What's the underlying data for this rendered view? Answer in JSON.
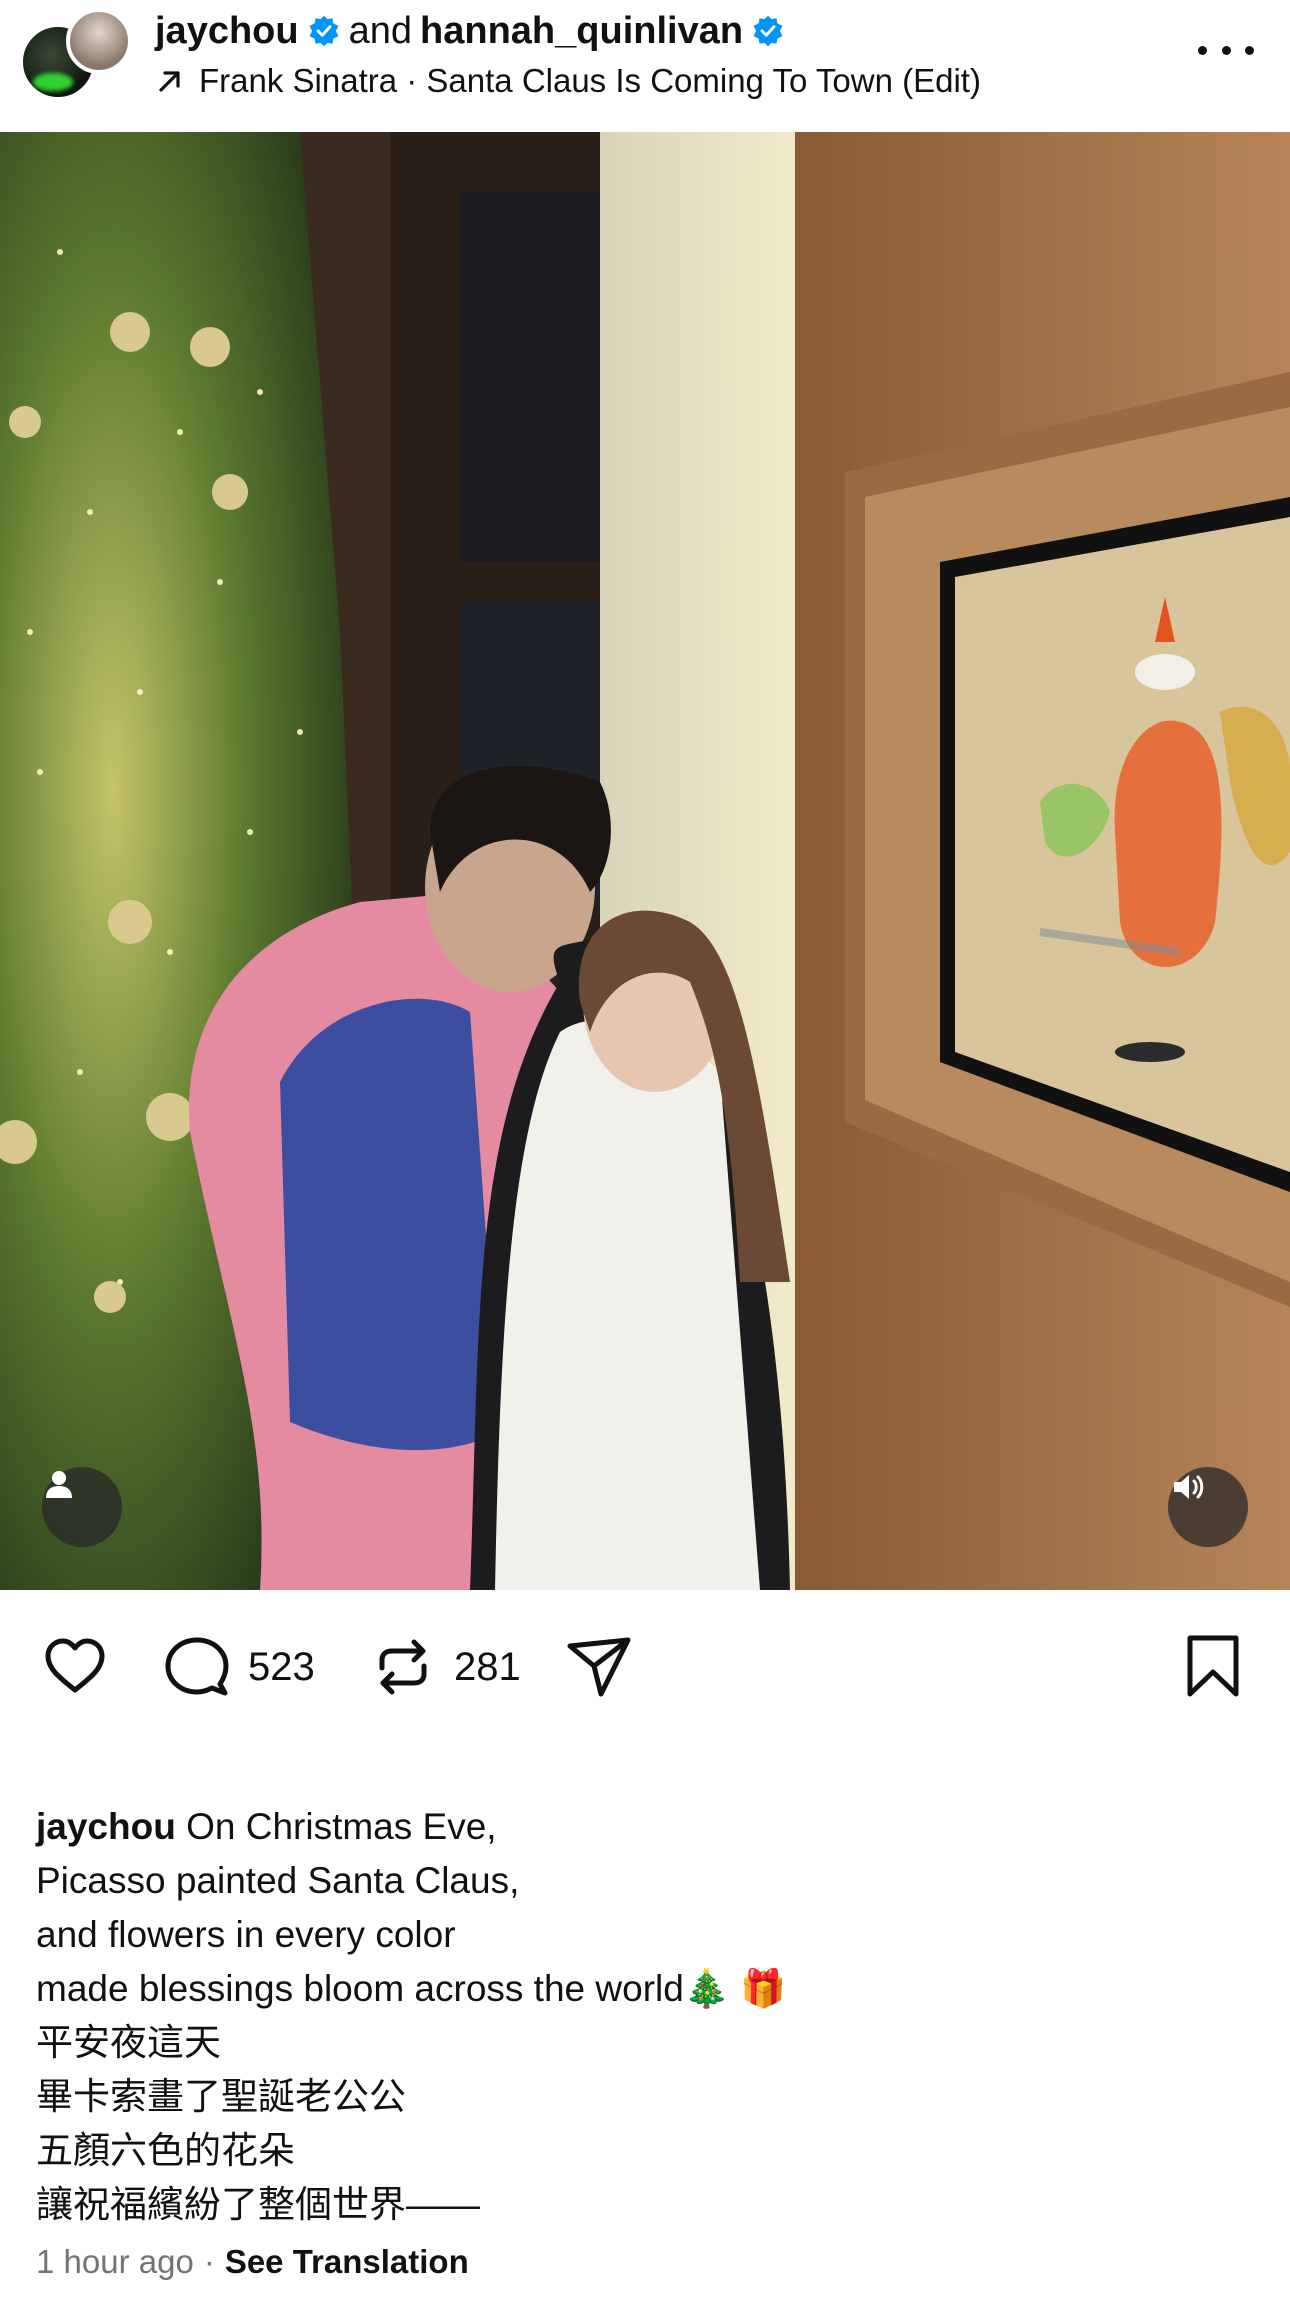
{
  "header": {
    "user1": "jaychou",
    "joiner": "and",
    "user2": "hannah_quinlivan",
    "audio": "Frank Sinatra · Santa Claus Is Coming To Town (Edit)"
  },
  "actions": {
    "comments": "523",
    "reposts": "281"
  },
  "caption": {
    "author": "jaychou",
    "lines": [
      "On Christmas Eve,",
      "Picasso painted Santa Claus,",
      "and flowers in every color",
      "made blessings bloom across the world",
      "平安夜這天",
      "畢卡索畫了聖誕老公公",
      "五顏六色的花朵",
      "讓祝福繽紛了整個世界——"
    ],
    "emojis": "🎄 🎁"
  },
  "meta": {
    "time": "1 hour ago",
    "dot": "·",
    "translate": "See Translation"
  },
  "colors": {
    "verified": "#0095f6",
    "text": "#111111",
    "muted": "#737373"
  }
}
